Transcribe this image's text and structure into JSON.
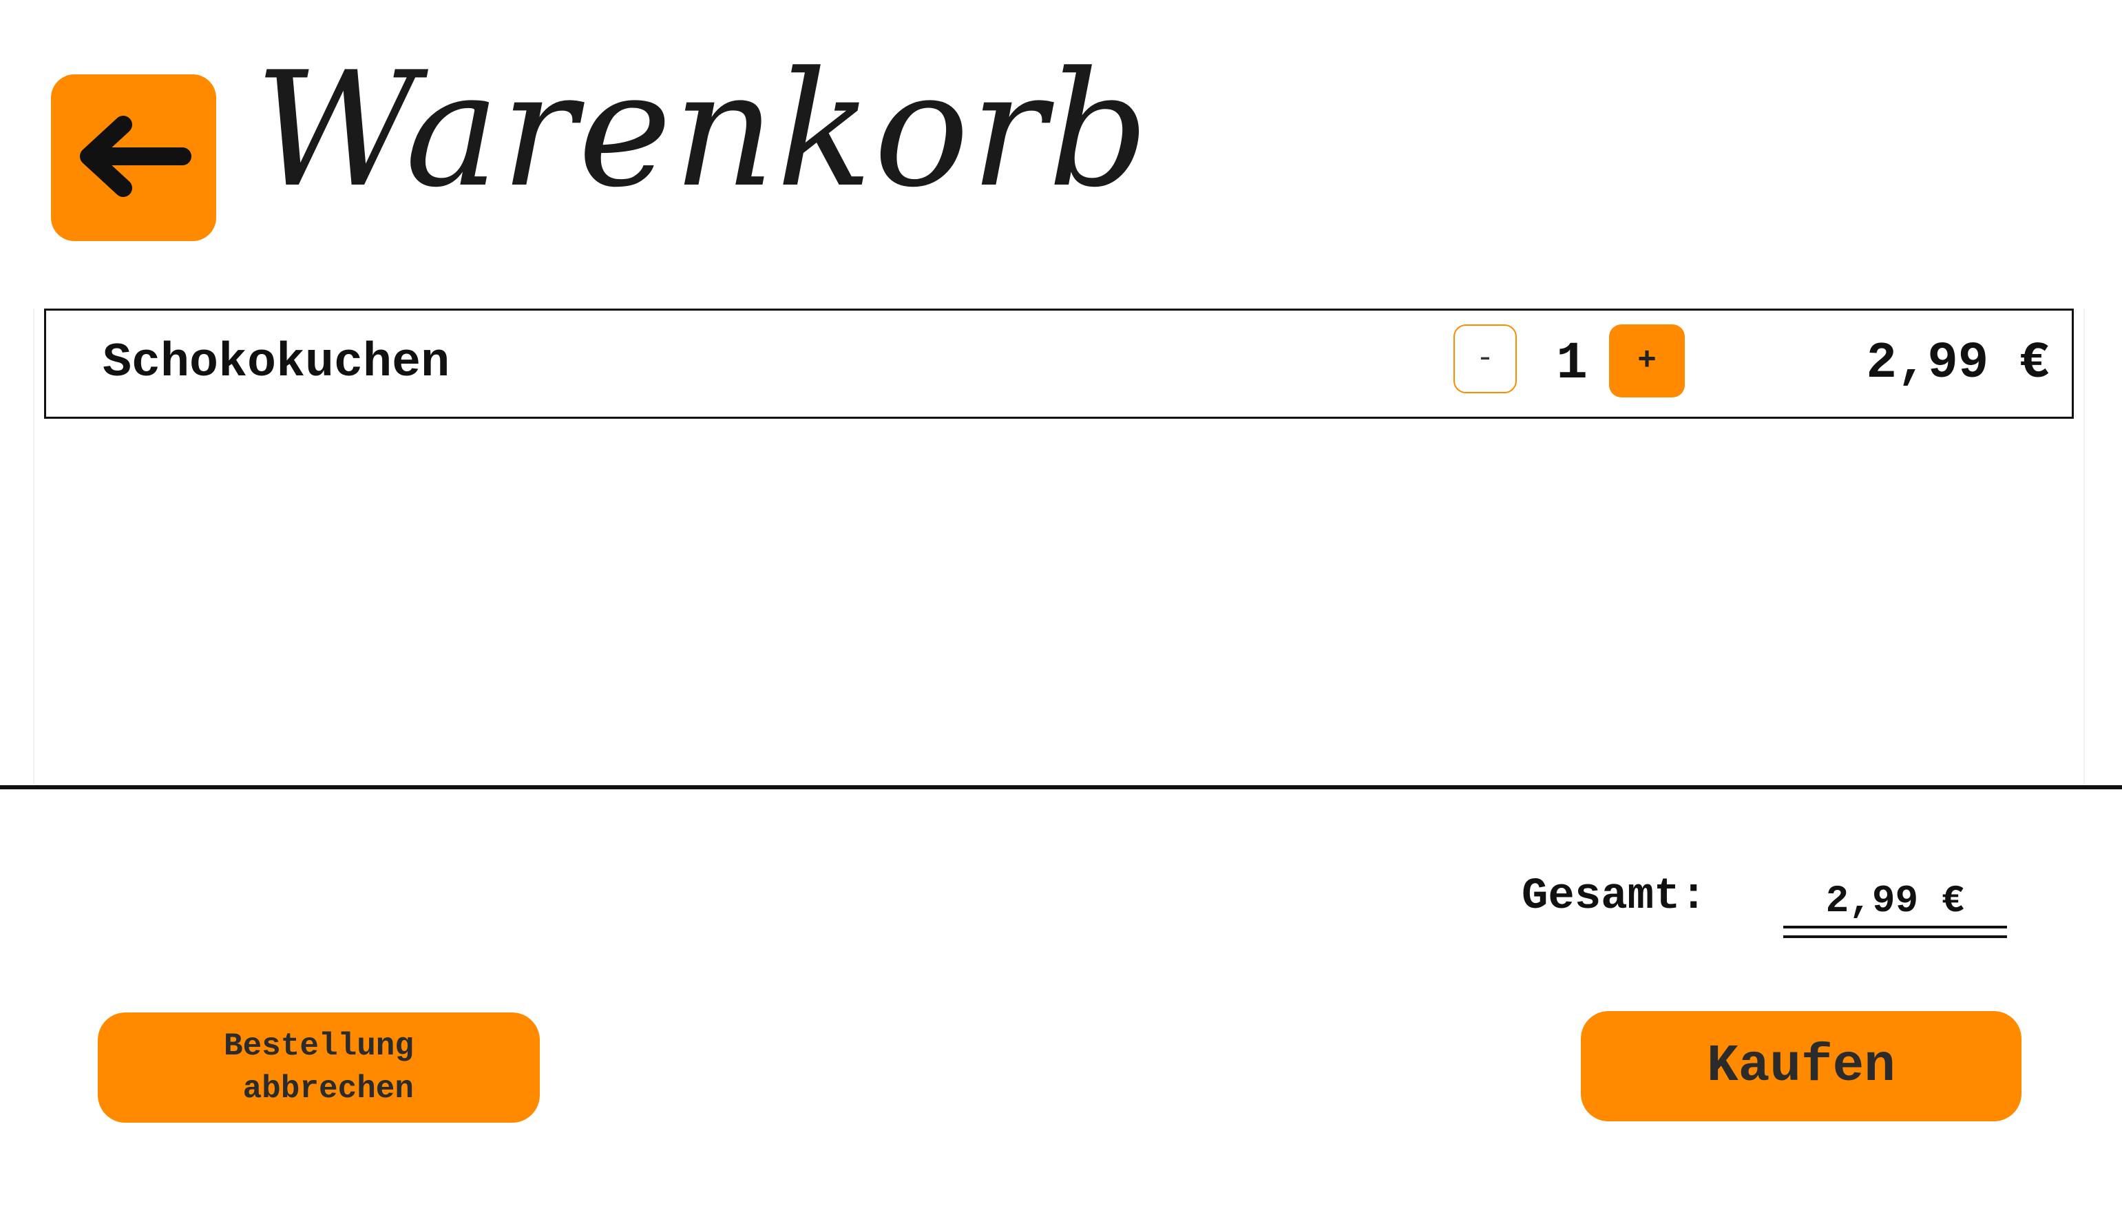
{
  "header": {
    "back_icon": "arrow-left-icon",
    "title": "Warenkorb"
  },
  "cart": {
    "items": [
      {
        "name": "Schokokuchen",
        "decrease_label": "-",
        "quantity": "1",
        "increase_label": "+",
        "price": "2,99 €"
      }
    ]
  },
  "summary": {
    "total_label": "Gesamt:",
    "total_value": "2,99 €"
  },
  "actions": {
    "cancel_label": "Bestellung\n abbrechen",
    "buy_label": "Kaufen"
  },
  "colors": {
    "accent": "#ff8a00",
    "text": "#111111",
    "background": "#ffffff"
  }
}
